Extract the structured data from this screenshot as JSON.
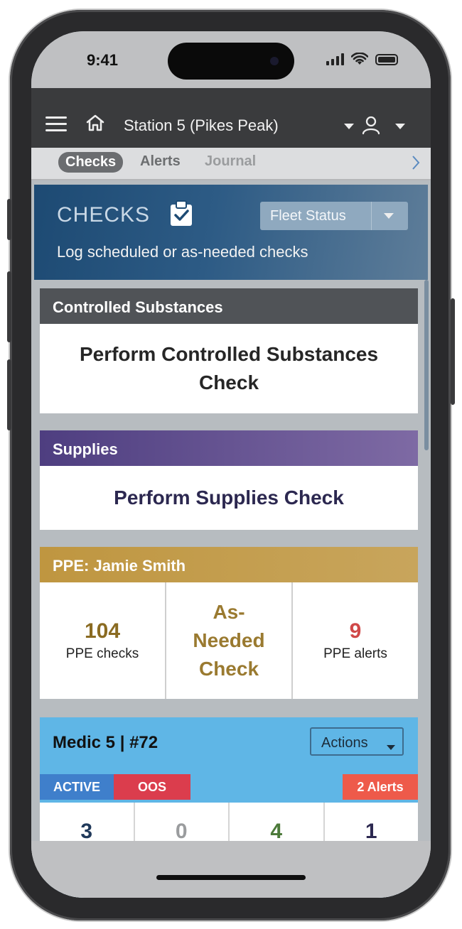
{
  "status_bar": {
    "time": "9:41"
  },
  "navbar": {
    "station": "Station 5 (Pikes Peak)"
  },
  "tabs": [
    {
      "label": "Checks",
      "active": true
    },
    {
      "label": "Alerts"
    },
    {
      "label": "Journal"
    }
  ],
  "hero": {
    "title": "CHECKS",
    "subtitle": "Log scheduled or as-needed checks",
    "fleet_button": "Fleet Status"
  },
  "controlled_substances": {
    "header": "Controlled Substances",
    "action_line1": "Perform Controlled Substances",
    "action_line2": "Check"
  },
  "supplies": {
    "header": "Supplies",
    "action": "Perform Supplies Check"
  },
  "ppe": {
    "header": "PPE: Jamie Smith",
    "checks_count": "104",
    "checks_label": "PPE checks",
    "as_needed_line1": "As-",
    "as_needed_line2": "Needed",
    "as_needed_line3": "Check",
    "alerts_count": "9",
    "alerts_label": "PPE alerts"
  },
  "unit": {
    "title": "Medic 5 | #72",
    "actions_label": "Actions",
    "badges": {
      "active": "ACTIVE",
      "oos": "OOS",
      "alerts": "2 Alerts"
    },
    "counts": [
      {
        "value": "3",
        "color": "#20395a"
      },
      {
        "value": "0",
        "color": "#9a9c9e"
      },
      {
        "value": "4",
        "color": "#4c7a3a"
      },
      {
        "value": "1",
        "color": "#2c2850"
      }
    ]
  },
  "colors": {
    "navbar": "#3a3b3d",
    "hero": "#1d4a73",
    "controlled_header": "#505357",
    "supplies_header": "#4e3e80",
    "ppe_header": "#bf9640",
    "unit_card": "#5fb6e6",
    "active_badge": "#3f7fcb",
    "oos_badge": "#db3d4d",
    "alerts_badge": "#ee5a4a"
  },
  "icons": [
    "menu-icon",
    "home-icon",
    "user-icon",
    "clipboard-check-icon",
    "chevron-right-icon",
    "caret-down-icon",
    "wifi-icon",
    "signal-icon",
    "battery-icon"
  ]
}
